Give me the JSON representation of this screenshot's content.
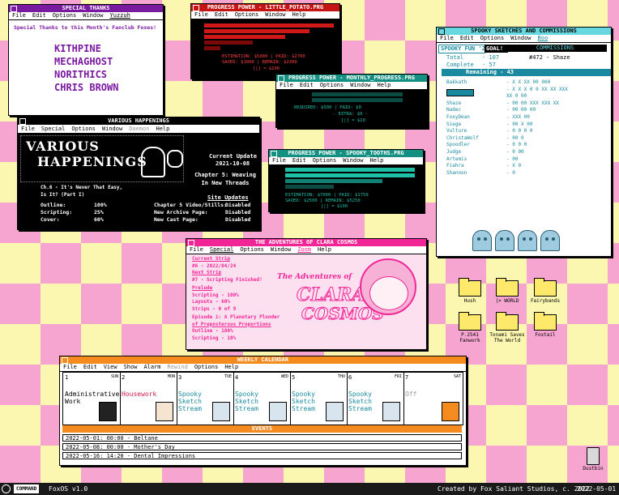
{
  "special_thanks": {
    "title": "SPECIAL THANKS",
    "menu": [
      "File",
      "Edit",
      "Options",
      "Window",
      "Yuzzuh"
    ],
    "heading": "Special Thanks to this Month's Fanclub Foxes!",
    "names": [
      "KITHPINE",
      "MECHAGHOST",
      "NORITHICS",
      "CHRIS BROWN"
    ]
  },
  "potato": {
    "title": "PROGRESS POWER - LITTLE_POTATO.PRG",
    "menu": [
      "File",
      "Edit",
      "Options",
      "Window",
      "Help"
    ],
    "estimation_line": "ESTIMATION: $5000 | PAID:      $2700",
    "saved_line": "SAVED:       $1000 | REMAIN:    $2300",
    "bottom_line": "[|]  = $100"
  },
  "monthly": {
    "title": "PROGRESS POWER - MONTHLY_PROGRESS.PRG",
    "menu": [
      "File",
      "Edit",
      "Options",
      "Window",
      "Help"
    ],
    "required_line": "REQUIRED: $500 | PAID:        $0",
    "extra_line": "- EXTRA: $0 -",
    "bottom_line": "[|] = $10"
  },
  "spooky_tooth": {
    "title": "PROGRESS POWER - SPOOKY_TOOTHS.PRG",
    "menu": [
      "File",
      "Edit",
      "Options",
      "Window",
      "Help"
    ],
    "estimation_line": "ESTIMATION: $7000 | PAID:       $1750",
    "saved_line": "SAVED:       $2500 | REMAIN:    $5250",
    "bottom_line": "[|] = $100"
  },
  "happenings": {
    "title": "VARIOUS HAPPENINGS",
    "menu": [
      "File",
      "Special",
      "Options",
      "Window",
      "Daemon",
      "Help"
    ],
    "logo_line1": "VARIOUS",
    "logo_line2": "HAPPENINGS",
    "update_label": "Current Update",
    "update_date": "2021-10-08",
    "chapter_title": "Chapter 5: Weaving In New Threads",
    "episode": "Ch.6 - It's Never That Easy, Is It? (Part I)",
    "site_updates": "Site Updates",
    "progress": [
      {
        "label": "Outline:",
        "value": "100%"
      },
      {
        "label": "Scripting:",
        "value": "25%"
      },
      {
        "label": "Cover:",
        "value": "60%"
      }
    ],
    "site": [
      {
        "label": "Chapter 5 Video/Stills:",
        "value": "Disabled"
      },
      {
        "label": "New Archive Page:",
        "value": "Disabled"
      },
      {
        "label": "New Cast Page:",
        "value": "Disabled"
      }
    ]
  },
  "commissions": {
    "title": "SPOOKY SKETCHES AND COMMISSIONS",
    "menu": [
      "File",
      "Edit",
      "Options",
      "Window",
      "Boo"
    ],
    "fun_label": "SPOOKY FUN '21",
    "goal_label": "GOAL!!",
    "commissions_label": "COMMISSIONS",
    "current_commission": "#472 - Shaze",
    "total_label": "Total",
    "total_value": "- 107",
    "complete_label": "Complete",
    "complete_value": "- 57",
    "remaining_label": "Remaining - 43",
    "entries": [
      {
        "name": "Bakkath",
        "marks": "- X X XX 00 000"
      },
      {
        "name": "",
        "marks": "- X X X 0 0 XX XX XXX"
      },
      {
        "name": "",
        "marks": "  XX 0 00"
      },
      {
        "name": "Shaze",
        "marks": "- 00 00 XXX XXX XX"
      },
      {
        "name": "Nadec",
        "marks": "- 00 00 00"
      },
      {
        "name": "FoxyDean",
        "marks": "- XXX 00"
      },
      {
        "name": "Siege",
        "marks": "- 00 X 00"
      },
      {
        "name": "Vulture",
        "marks": "- 0 0 0 0"
      },
      {
        "name": "ChristaWolf",
        "marks": "- 00 0"
      },
      {
        "name": "Spoodler",
        "marks": "- 0 0 0"
      },
      {
        "name": "Judge",
        "marks": "- 0 00"
      },
      {
        "name": "Artemis",
        "marks": "- 00"
      },
      {
        "name": "Fiahra",
        "marks": "- X 0"
      },
      {
        "name": "Shannon",
        "marks": "- 0"
      }
    ]
  },
  "clara": {
    "title": "THE ADVENTURES OF CLARA COSMOS",
    "menu": [
      "File",
      "Special",
      "Options",
      "Window",
      "Zoom",
      "Help"
    ],
    "current_label": "Current Strip",
    "current_value": "#6 - 2022/04/24",
    "next_label": "Next Strip",
    "next_value": "#7 - Scripting Finished!",
    "prelude_label": "Prelude",
    "prelude_lines": [
      "Scripting - 100%",
      "Layouts - 60%",
      "Strips - 0 of 9"
    ],
    "episode_line1": "Episode 1: A Planetary Plunder",
    "episode_line2": "of Preposterous Proportions",
    "episode_lines": [
      "Outline - 100%",
      "Scripting - 10%"
    ],
    "logo_top": "The Adventures of",
    "logo_bottom1": "CLARA",
    "logo_bottom2": "COSMOS"
  },
  "desktop_icons": [
    {
      "label": "Hush"
    },
    {
      "label": "|> WORLD"
    },
    {
      "label": "Fairybands"
    },
    {
      "label": "P.2541 Fanwork"
    },
    {
      "label": "Tonami Saves The World"
    },
    {
      "label": "Foxtail"
    }
  ],
  "dustbin_label": "Dustbin",
  "calendar": {
    "title": "WEEKLY CALENDAR",
    "menu": [
      "File",
      "Edit",
      "View",
      "Show",
      "Alarm",
      "Rewind",
      "Options",
      "Help"
    ],
    "days": [
      {
        "num": "1",
        "day": "SUN",
        "event": "Administrative Work"
      },
      {
        "num": "2",
        "day": "MON",
        "event": "Housework"
      },
      {
        "num": "3",
        "day": "TUE",
        "event": "Spooky Sketch Stream"
      },
      {
        "num": "4",
        "day": "WED",
        "event": "Spooky Sketch Stream"
      },
      {
        "num": "5",
        "day": "THU",
        "event": "Spooky Sketch Stream"
      },
      {
        "num": "6",
        "day": "FRI",
        "event": "Spooky Sketch Stream"
      },
      {
        "num": "7",
        "day": "SAT",
        "event": "Off"
      }
    ],
    "events_label": "EVENTS",
    "events": [
      "2022-05-01: 00:00 - Beltane",
      "2022-05-08: 00:00 - Mother's Day",
      "2022-05-16: 14:20 - Dental Impressions"
    ],
    "colors": {
      "admin": "#000000",
      "housework": "#d01a4a",
      "stream": "#1a8aa0",
      "off": "#999999"
    }
  },
  "taskbar": {
    "command": "COMMAND",
    "os": "FoxOS v1.0",
    "credit": "Created by Fox Saliant Studios, c. 2022",
    "date": "2022-05-01"
  }
}
